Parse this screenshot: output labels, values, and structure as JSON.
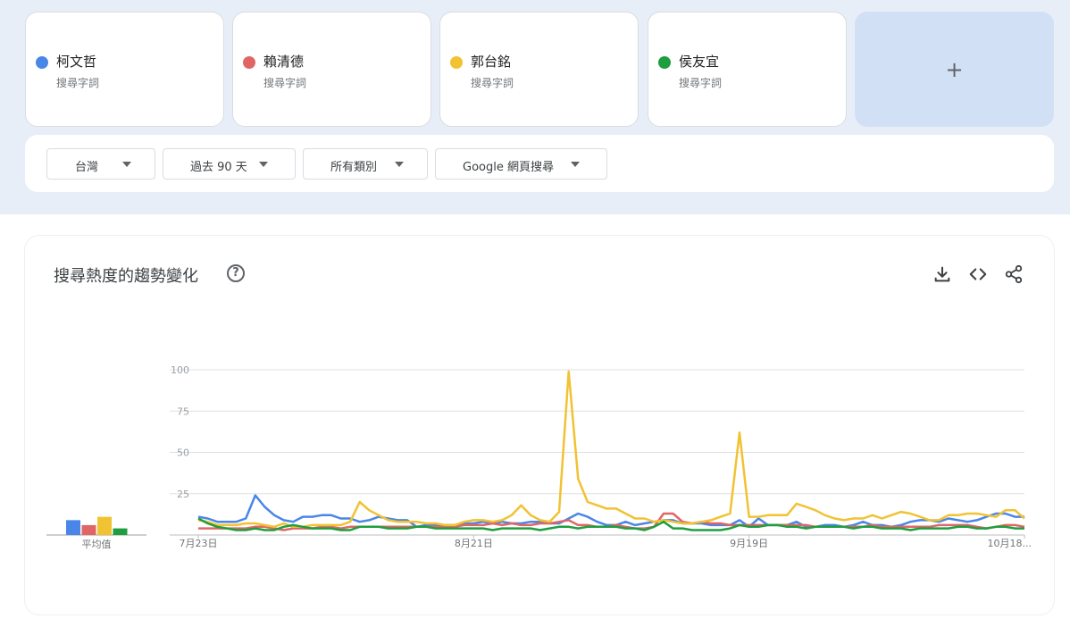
{
  "terms": [
    {
      "name": "柯文哲",
      "sub": "搜尋字詞",
      "color": "#4a86e8"
    },
    {
      "name": "賴清德",
      "sub": "搜尋字詞",
      "color": "#e06666"
    },
    {
      "name": "郭台銘",
      "sub": "搜尋字詞",
      "color": "#f1c232"
    },
    {
      "name": "侯友宜",
      "sub": "搜尋字詞",
      "color": "#1e9e3e"
    }
  ],
  "add_label": "+",
  "filters": {
    "region": "台灣",
    "period": "過去 90 天",
    "category": "所有類別",
    "source": "Google 網頁搜尋"
  },
  "chart_section": {
    "title": "搜尋熱度的趨勢變化",
    "help_symbol": "?",
    "icons": [
      "download-icon",
      "embed-icon",
      "share-icon"
    ]
  },
  "chart_data": {
    "type": "line",
    "ylim": [
      0,
      100
    ],
    "y_ticks": [
      "100",
      "75",
      "50",
      "25"
    ],
    "x_tick_labels": [
      {
        "index": 0,
        "label": "7月23日"
      },
      {
        "index": 29,
        "label": "8月21日"
      },
      {
        "index": 58,
        "label": "9月19日"
      },
      {
        "index": 87,
        "label": "10月18..."
      }
    ],
    "average_label": "平均值",
    "averages": [
      9,
      6,
      11,
      4
    ],
    "grid": true,
    "series": [
      {
        "name": "柯文哲",
        "color": "#4a86e8",
        "values": [
          11,
          10,
          8,
          8,
          8,
          10,
          24,
          17,
          12,
          9,
          8,
          11,
          11,
          12,
          12,
          10,
          10,
          8,
          9,
          11,
          10,
          9,
          9,
          5,
          6,
          6,
          6,
          6,
          7,
          7,
          8,
          7,
          8,
          7,
          7,
          8,
          8,
          7,
          7,
          10,
          13,
          11,
          8,
          6,
          6,
          8,
          6,
          7,
          8,
          9,
          9,
          7,
          7,
          7,
          6,
          6,
          6,
          9,
          5,
          10,
          6,
          6,
          6,
          8,
          5,
          5,
          6,
          6,
          5,
          6,
          8,
          6,
          6,
          5,
          6,
          8,
          9,
          9,
          8,
          10,
          9,
          8,
          9,
          11,
          13,
          13,
          11,
          11
        ]
      },
      {
        "name": "賴清德",
        "color": "#e06666",
        "values": [
          4,
          4,
          4,
          4,
          4,
          4,
          5,
          5,
          4,
          3,
          4,
          4,
          4,
          5,
          5,
          4,
          5,
          5,
          5,
          5,
          5,
          5,
          5,
          5,
          5,
          5,
          5,
          5,
          6,
          6,
          6,
          7,
          6,
          7,
          6,
          6,
          7,
          7,
          8,
          9,
          6,
          6,
          5,
          5,
          6,
          5,
          4,
          4,
          5,
          13,
          13,
          8,
          7,
          8,
          7,
          7,
          6,
          6,
          6,
          6,
          6,
          6,
          6,
          6,
          6,
          5,
          5,
          5,
          5,
          5,
          5,
          6,
          5,
          5,
          5,
          5,
          5,
          5,
          6,
          6,
          6,
          6,
          5,
          4,
          5,
          6,
          6,
          5
        ]
      },
      {
        "name": "郭台銘",
        "color": "#f1c232",
        "values": [
          9,
          8,
          6,
          6,
          6,
          7,
          7,
          6,
          5,
          7,
          5,
          5,
          6,
          6,
          6,
          6,
          8,
          20,
          15,
          12,
          9,
          8,
          8,
          8,
          7,
          7,
          6,
          6,
          8,
          9,
          9,
          8,
          9,
          12,
          18,
          12,
          9,
          8,
          14,
          99,
          34,
          20,
          18,
          16,
          16,
          13,
          10,
          10,
          8,
          9,
          8,
          7,
          7,
          8,
          9,
          11,
          13,
          62,
          11,
          11,
          12,
          12,
          12,
          19,
          17,
          15,
          12,
          10,
          9,
          10,
          10,
          12,
          10,
          12,
          14,
          13,
          11,
          9,
          9,
          12,
          12,
          13,
          13,
          12,
          11,
          15,
          15,
          10
        ]
      },
      {
        "name": "侯友宜",
        "color": "#1e9e3e",
        "values": [
          10,
          7,
          5,
          4,
          3,
          3,
          4,
          3,
          3,
          5,
          6,
          5,
          4,
          4,
          4,
          3,
          3,
          5,
          5,
          5,
          4,
          4,
          4,
          5,
          5,
          4,
          4,
          4,
          4,
          4,
          4,
          3,
          4,
          4,
          4,
          4,
          3,
          4,
          5,
          5,
          4,
          5,
          5,
          5,
          5,
          4,
          4,
          3,
          5,
          8,
          4,
          4,
          3,
          3,
          3,
          3,
          4,
          6,
          5,
          5,
          6,
          6,
          5,
          5,
          4,
          5,
          5,
          5,
          5,
          4,
          5,
          5,
          4,
          4,
          4,
          3,
          4,
          4,
          4,
          4,
          5,
          5,
          4,
          4,
          5,
          5,
          4,
          4
        ]
      }
    ]
  }
}
